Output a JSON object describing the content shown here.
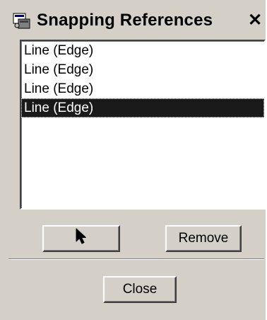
{
  "window": {
    "title": "Snapping References",
    "close_glyph": "✕",
    "icon": "app-icon"
  },
  "list": {
    "items": [
      {
        "label": "Line (Edge)",
        "selected": false
      },
      {
        "label": "Line (Edge)",
        "selected": false
      },
      {
        "label": "Line (Edge)",
        "selected": false
      },
      {
        "label": "Line (Edge)",
        "selected": true
      }
    ],
    "selection_color": "#1a1a1a"
  },
  "buttons": {
    "pick_icon": "arrow-cursor-icon",
    "remove_label": "Remove",
    "close_label": "Close"
  },
  "colors": {
    "face": "#d4d0c8",
    "list_bg": "#ffffff"
  }
}
